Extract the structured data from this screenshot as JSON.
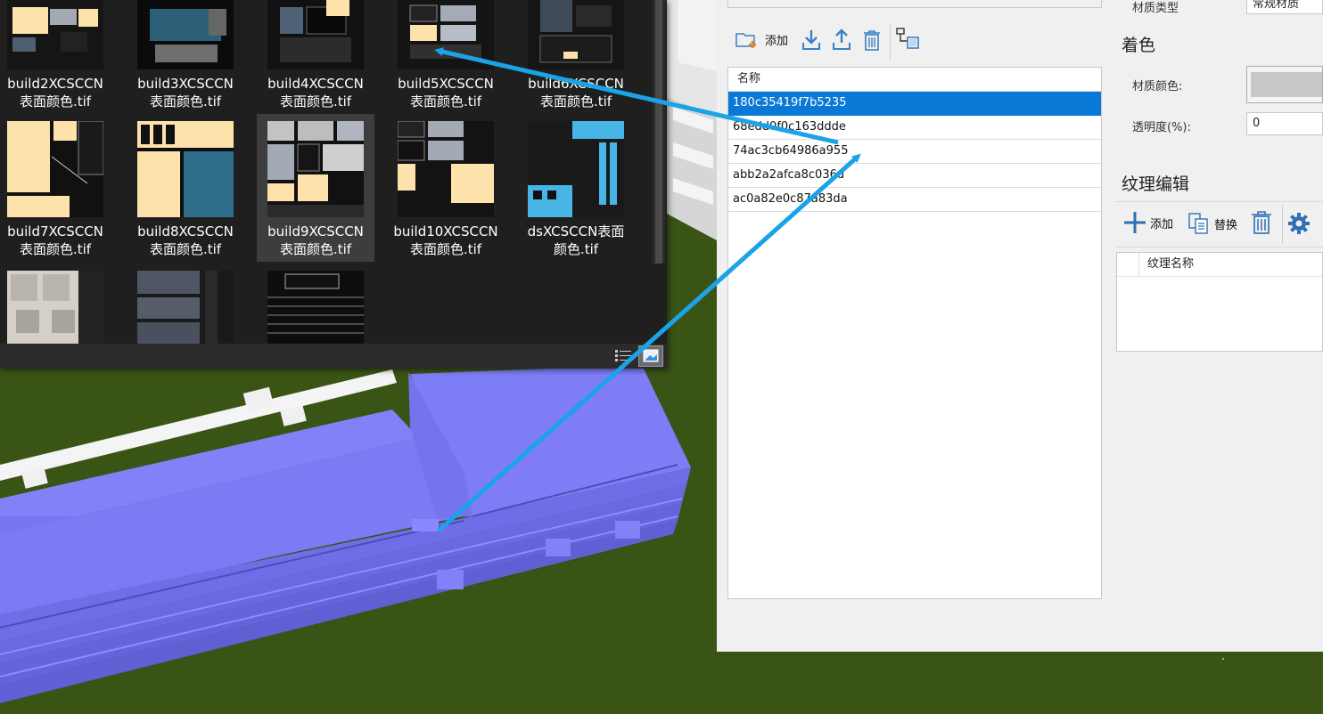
{
  "file_browser": {
    "thumbnails": [
      {
        "line1": "build2XCSCCN",
        "line2": "表面颜色.tif"
      },
      {
        "line1": "build3XCSCCN",
        "line2": "表面颜色.tif"
      },
      {
        "line1": "build4XCSCCN",
        "line2": "表面颜色.tif"
      },
      {
        "line1": "build5XCSCCN",
        "line2": "表面颜色.tif"
      },
      {
        "line1": "build6XCSCCN",
        "line2": "表面颜色.tif"
      },
      {
        "line1": "build7XCSCCN",
        "line2": "表面颜色.tif"
      },
      {
        "line1": "build8XCSCCN",
        "line2": "表面颜色.tif"
      },
      {
        "line1": "build9XCSCCN",
        "line2": "表面颜色.tif"
      },
      {
        "line1": "build10XCSCCN",
        "line2": "表面颜色.tif"
      },
      {
        "line1": "dsXCSCCN表面",
        "line2": "颜色.tif"
      }
    ],
    "selected_index": 7
  },
  "material_panel": {
    "toolbar": {
      "add_label": "添加"
    },
    "list_header": "名称",
    "materials": [
      "180c35419f7b5235",
      "68edd0f0c163ddde",
      "74ac3cb64986a955",
      "abb2a2afca8c036d",
      "ac0a82e0c87a83da"
    ],
    "selected_material": 0
  },
  "properties": {
    "material_type_label": "材质类型",
    "material_type_value": "常规材质",
    "coloring_section": "着色",
    "material_color_label": "材质颜色:",
    "material_color": "#c8c8c8",
    "transparency_label": "透明度(%):",
    "transparency_value": "0",
    "texture_section": "纹理编辑",
    "texture_toolbar": {
      "add_label": "添加",
      "replace_label": "替换"
    },
    "texture_list_header": "纹理名称"
  },
  "colors": {
    "accent_blue": "#0a78d7",
    "arrow_blue": "#1aa3e8",
    "building_purple": "#7a78f2",
    "grass": "#3a5416"
  }
}
